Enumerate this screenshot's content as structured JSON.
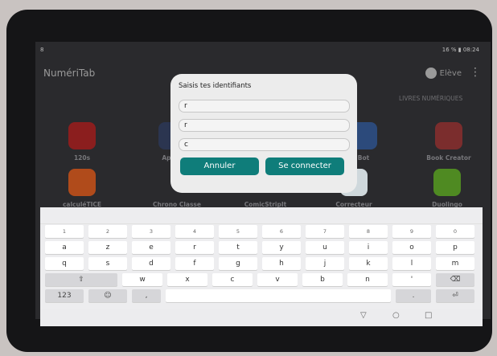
{
  "statusbar": {
    "left": "8",
    "right": "16 % ▮ 08:24"
  },
  "app": {
    "title": "NumériTab",
    "user": "Elève",
    "section_right": "LIVRES NUMÉRIQUES"
  },
  "apps": [
    {
      "label": "120s"
    },
    {
      "label": "Appar"
    },
    {
      "label": "Bot"
    },
    {
      "label": "Book Creator"
    },
    {
      "label": "calculéTICE"
    },
    {
      "label": "Chrono Classe"
    },
    {
      "label": "ComicStripIt"
    },
    {
      "label": "Correcteur"
    },
    {
      "label": "Duolingo"
    }
  ],
  "dialog": {
    "title": "Saisis tes identifiants",
    "field1": "r",
    "field2": "r",
    "field3": "c",
    "cancel_label": "Annuler",
    "connect_label": "Se connecter"
  },
  "keyboard": {
    "row0": [
      "1",
      "2",
      "3",
      "4",
      "5",
      "6",
      "7",
      "8",
      "9",
      "0"
    ],
    "row1": [
      "a",
      "z",
      "e",
      "r",
      "t",
      "y",
      "u",
      "i",
      "o",
      "p"
    ],
    "row2": [
      "q",
      "s",
      "d",
      "f",
      "g",
      "h",
      "j",
      "k",
      "l",
      "m"
    ],
    "row3": [
      "w",
      "x",
      "c",
      "v",
      "b",
      "n"
    ],
    "num_key": "123",
    "comma_key": ","
  },
  "navbar": {
    "back": "▽",
    "home": "○",
    "recent": "□"
  }
}
